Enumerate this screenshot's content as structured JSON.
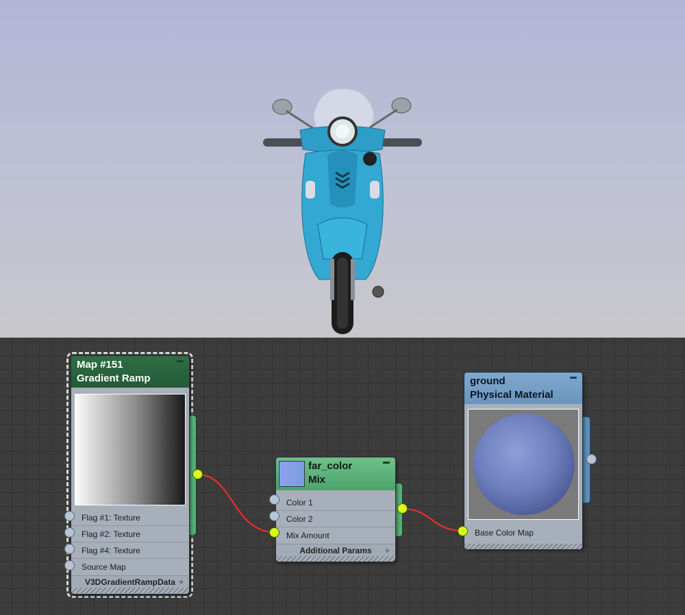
{
  "viewport": {
    "subject": "scooter-render"
  },
  "nodes": {
    "gradient_ramp": {
      "title": "Map #151",
      "type": "Gradient Ramp",
      "slots": [
        "Flag #1: Texture",
        "Flag #2: Texture",
        "Flag #4: Texture",
        "Source Map"
      ],
      "footer": "V3DGradientRampData"
    },
    "mix": {
      "title": "far_color",
      "type": "Mix",
      "slots": [
        "Color 1",
        "Color 2",
        "Mix Amount"
      ],
      "footer": "Additional Params"
    },
    "material": {
      "title": "ground",
      "type": "Physical Material",
      "slots": [
        "Base Color Map"
      ]
    }
  },
  "colors": {
    "header_green": "#2f6e45",
    "header_mix": "#6fc08a",
    "header_blue": "#7fa8cf",
    "socket_active": "#d6ff1a",
    "wire": "#ff2a2a"
  }
}
